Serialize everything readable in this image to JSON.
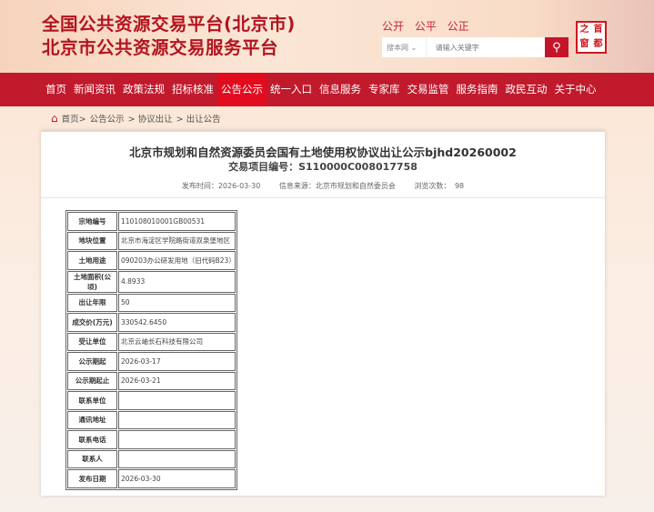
{
  "header": {
    "title1": "全国公共资源交易平台(北京市)",
    "title2": "北京市公共资源交易服务平台",
    "slogan": "公开 公平 公正",
    "search_scope": "搜本网",
    "search_placeholder": "请输入关键字",
    "logo_text": "首都之窗"
  },
  "nav": [
    "首页",
    "新闻资讯",
    "政策法规",
    "招标核准",
    "公告公示",
    "统一入口",
    "信息服务",
    "专家库",
    "交易监管",
    "服务指南",
    "政民互动",
    "关于中心"
  ],
  "breadcrumb": [
    "首页>",
    "公告公示",
    "> 协议出让",
    "> 出让公告"
  ],
  "article": {
    "title": "北京市规划和自然资源委员会国有土地使用权协议出让公示bjhd20260002",
    "project_no": "交易项目编号：S110000C008017758",
    "publish_time": "发布时间：2026-03-30",
    "source": "信息来源：北京市规划和自然委员会",
    "views": "浏览次数： 98"
  },
  "table": [
    [
      "宗地编号",
      "110108010001GB00531"
    ],
    [
      "地块位置",
      "北京市海淀区学院路街道双泉堡地区"
    ],
    [
      "土地用途",
      "090203办公研发用地（旧代码B23）"
    ],
    [
      "土地面积(公顷)",
      "4.8933"
    ],
    [
      "出让年限",
      "50"
    ],
    [
      "成交价(万元)",
      "330542.6450"
    ],
    [
      "受让单位",
      "北京云岫长石科技有限公司"
    ],
    [
      "公示期起",
      "2026-03-17"
    ],
    [
      "公示期起止",
      "2026-03-21"
    ],
    [
      "联系单位",
      ""
    ],
    [
      "通讯地址",
      ""
    ],
    [
      "联系电话",
      ""
    ],
    [
      "联系人",
      ""
    ],
    [
      "发布日期",
      "2026-03-30"
    ]
  ]
}
